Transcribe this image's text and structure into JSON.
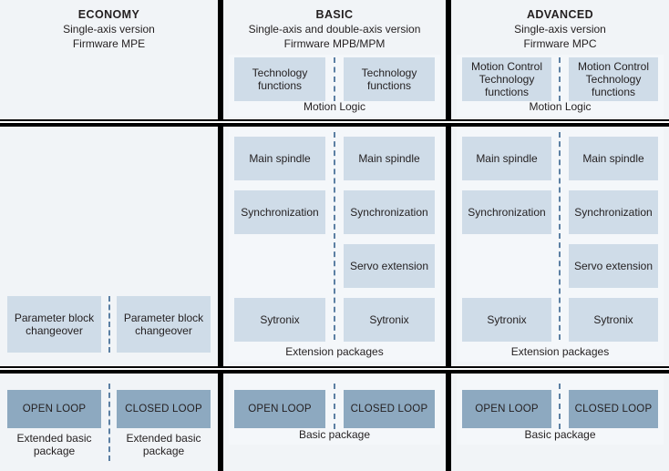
{
  "columns": [
    {
      "id": "economy",
      "title": "ECONOMY",
      "sub1": "Single-axis version",
      "sub2": "Firmware MPE",
      "header_group_caption": "",
      "header_boxes": [],
      "mid_group_caption": "",
      "mid_boxes_left": [
        {
          "label": "Parameter block changeover"
        }
      ],
      "mid_boxes_right": [
        {
          "label": "Parameter block changeover"
        }
      ],
      "foot_left_box": "OPEN LOOP",
      "foot_right_box": "CLOSED LOOP",
      "foot_caption": "",
      "foot_left_label": "Extended basic package",
      "foot_right_label": "Extended basic package"
    },
    {
      "id": "basic",
      "title": "BASIC",
      "sub1": "Single-axis and double-axis version",
      "sub2": "Firmware MPB/MPM",
      "header_group_caption": "Motion Logic",
      "header_boxes_left": [
        {
          "label": "Technology functions"
        }
      ],
      "header_boxes_right": [
        {
          "label": "Technology functions"
        }
      ],
      "mid_group_caption": "Extension packages",
      "mid_boxes_left": [
        {
          "label": "Main spindle"
        },
        {
          "label": "Synchronization"
        },
        {
          "label": "Sytronix"
        }
      ],
      "mid_boxes_right": [
        {
          "label": "Main spindle"
        },
        {
          "label": "Synchronization"
        },
        {
          "label": "Servo extension"
        },
        {
          "label": "Sytronix"
        }
      ],
      "foot_left_box": "OPEN LOOP",
      "foot_right_box": "CLOSED LOOP",
      "foot_caption": "Basic package",
      "foot_left_label": "",
      "foot_right_label": ""
    },
    {
      "id": "advanced",
      "title": "ADVANCED",
      "sub1": "Single-axis version",
      "sub2": "Firmware MPC",
      "header_group_caption": "Motion Logic",
      "header_boxes_left": [
        {
          "label": "Motion Control Technology functions"
        }
      ],
      "header_boxes_right": [
        {
          "label": "Motion Control Technology functions"
        }
      ],
      "mid_group_caption": "Extension packages",
      "mid_boxes_left": [
        {
          "label": "Main spindle"
        },
        {
          "label": "Synchronization"
        },
        {
          "label": "Sytronix"
        }
      ],
      "mid_boxes_right": [
        {
          "label": "Main spindle"
        },
        {
          "label": "Synchronization"
        },
        {
          "label": "Servo extension"
        },
        {
          "label": "Sytronix"
        }
      ],
      "foot_left_box": "OPEN LOOP",
      "foot_right_box": "CLOSED LOOP",
      "foot_caption": "Basic package",
      "foot_left_label": "",
      "foot_right_label": ""
    }
  ],
  "colors": {
    "page_background": "#f1f4f7",
    "group_background": "#f4f7fa",
    "box_light": "#cfdce8",
    "box_dark": "#8da9c0",
    "divider": "#000000",
    "dashed_separator": "#5b7fa3",
    "text": "#231f20"
  }
}
